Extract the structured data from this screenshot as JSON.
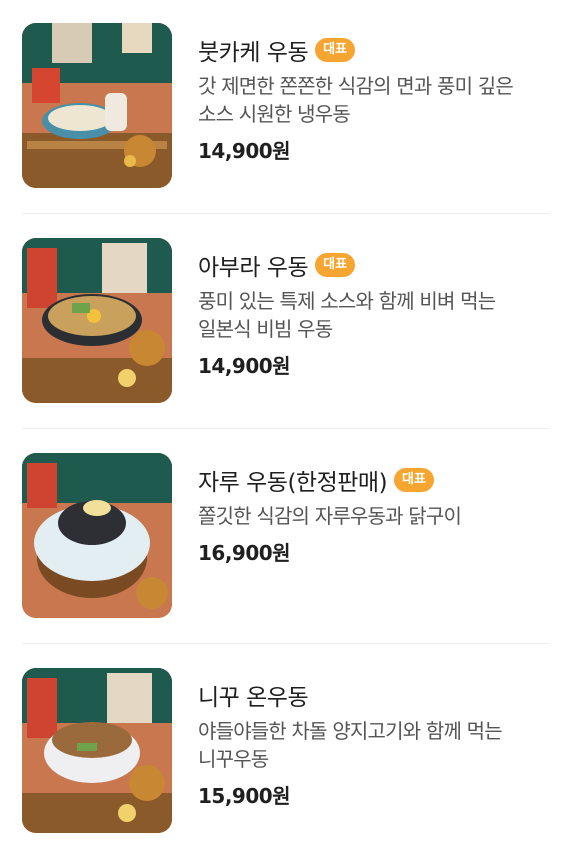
{
  "colors": {
    "badge": "#f7a531",
    "price": "#1f1f1f",
    "description": "#555555",
    "divider": "#eeeeee"
  },
  "menu": {
    "items": [
      {
        "name": "붓카케 우동",
        "badge": "대표",
        "description": "갓 제면한 쫀쫀한 식감의 면과 풍미 깊은 소스 시원한 냉우동",
        "price": "14,900원",
        "image_icon": "bukkake-udon-photo"
      },
      {
        "name": "아부라 우동",
        "badge": "대표",
        "description": "풍미 있는 특제 소스와 함께 비벼 먹는 일본식 비빔 우동",
        "price": "14,900원",
        "image_icon": "abura-udon-photo"
      },
      {
        "name": "자루 우동(한정판매)",
        "badge": "대표",
        "description": "쫄깃한 식감의 자루우동과 닭구이",
        "price": "16,900원",
        "image_icon": "zaru-udon-photo"
      },
      {
        "name": "니꾸 온우동",
        "badge": "",
        "description": "야들야들한 차돌 양지고기와 함께 먹는 니꾸우동",
        "price": "15,900원",
        "image_icon": "niku-udon-photo"
      }
    ]
  }
}
